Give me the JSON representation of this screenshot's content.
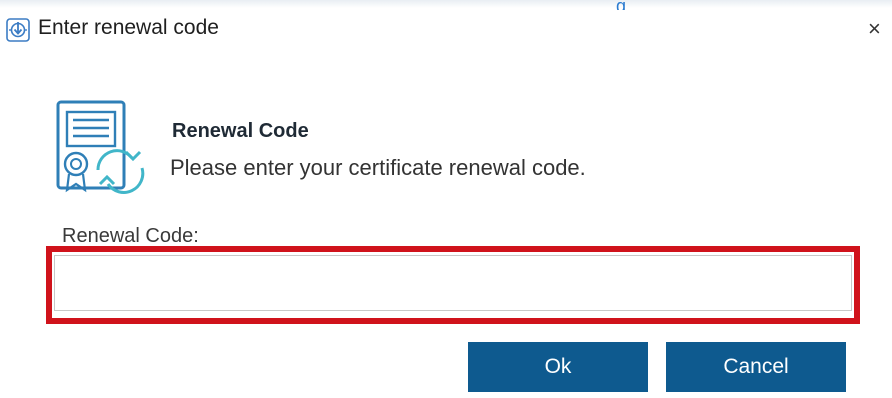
{
  "window": {
    "title": "Enter renewal code",
    "close_glyph": "×",
    "app_icon": "app-download-icon",
    "background_link_fragment": "g"
  },
  "header": {
    "icon": "certificate-renewal-icon",
    "title": "Renewal Code",
    "description": "Please enter your certificate renewal code."
  },
  "form": {
    "label": "Renewal Code:",
    "value": "",
    "placeholder": "",
    "highlight_color": "#d0121b"
  },
  "buttons": {
    "ok_label": "Ok",
    "cancel_label": "Cancel",
    "button_color": "#0e5a8f"
  }
}
